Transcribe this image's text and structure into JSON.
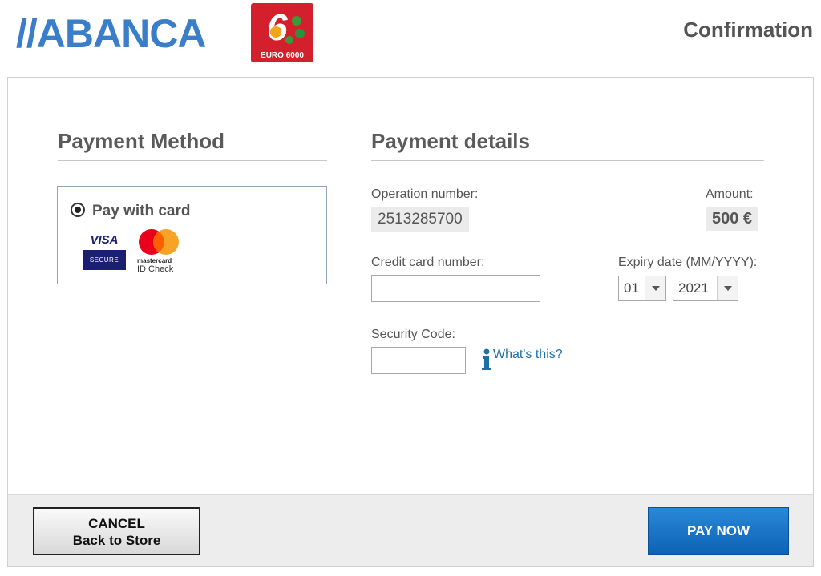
{
  "header": {
    "brand_logo_text": "//ABANCA",
    "network_logo_text": "EURO 6000",
    "page_heading": "Confirmation"
  },
  "payment_method": {
    "title": "Payment Method",
    "option_label": "Pay with card",
    "selected": true,
    "visa_badge": {
      "brand": "VISA",
      "caption": "SECURE"
    },
    "mastercard_badge": {
      "brand": "mastercard",
      "caption": "ID Check"
    }
  },
  "payment_details": {
    "title": "Payment details",
    "operation_label": "Operation number:",
    "operation_value": "2513285700",
    "amount_label": "Amount:",
    "amount_value": "500 €",
    "card_number_label": "Credit card number:",
    "card_number_value": "",
    "expiry_label": "Expiry date (MM/YYYY):",
    "expiry_month": "01",
    "expiry_year": "2021",
    "security_label": "Security Code:",
    "security_value": "",
    "whats_this_link": "What's this?"
  },
  "footer": {
    "cancel_line1": "CANCEL",
    "cancel_line2": "Back to Store",
    "pay_label": "PAY NOW"
  },
  "colors": {
    "brand_blue": "#3a7dc9",
    "pay_button": "#1672c7",
    "link": "#1f6fa8",
    "euro6000_red": "#d4202c"
  }
}
